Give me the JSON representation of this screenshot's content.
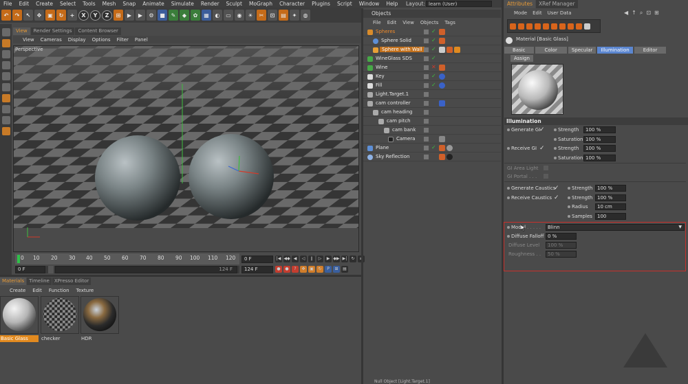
{
  "menubar": {
    "items": [
      "File",
      "Edit",
      "Create",
      "Select",
      "Tools",
      "Mesh",
      "Snap",
      "Animate",
      "Simulate",
      "Render",
      "Sculpt",
      "MoGraph",
      "Character",
      "Plugins",
      "Script",
      "Window",
      "Help"
    ],
    "layout_label": "Layout:",
    "layout_value": "learn (User)"
  },
  "toolbar": {
    "axis_x": "X",
    "axis_y": "Y",
    "axis_z": "Z"
  },
  "viewport": {
    "tabs": [
      "View",
      "Render Settings",
      "Content Browser"
    ],
    "menu": [
      "View",
      "Cameras",
      "Display",
      "Options",
      "Filter",
      "Panel"
    ],
    "label": "Perspective"
  },
  "timeline": {
    "ticks": [
      "0",
      "10",
      "20",
      "30",
      "40",
      "50",
      "60",
      "70",
      "80",
      "90",
      "100",
      "110",
      "120"
    ],
    "current": "0 F",
    "start": "0 F",
    "end_field": "124 F",
    "end": "124 F",
    "frame": "0 F"
  },
  "materials": {
    "tabs": [
      "Materials",
      "Timeline",
      "XPresso Editor"
    ],
    "menu": [
      "Create",
      "Edit",
      "Function",
      "Texture"
    ],
    "items": [
      {
        "name": "Basic Glass"
      },
      {
        "name": "checker"
      },
      {
        "name": "HDR"
      }
    ]
  },
  "objects": {
    "title": "Objects",
    "menu": [
      "File",
      "Edit",
      "View",
      "Objects",
      "Tags"
    ],
    "rows": [
      {
        "name": "Spheres"
      },
      {
        "name": "Sphere Solid"
      },
      {
        "name": "Sphere with Wall"
      },
      {
        "name": "WineGlass SDS"
      },
      {
        "name": "Wine"
      },
      {
        "name": "Key"
      },
      {
        "name": "Fill"
      },
      {
        "name": "Light.Target.1"
      },
      {
        "name": "cam controller"
      },
      {
        "name": "cam heading"
      },
      {
        "name": "cam pitch"
      },
      {
        "name": "cam bank"
      },
      {
        "name": "Camera"
      },
      {
        "name": "Plane"
      },
      {
        "name": "Sky Reflection"
      }
    ],
    "status": "Null Object [Light.Target.1]"
  },
  "attributes": {
    "tabs": [
      "Attributes",
      "XRef Manager"
    ],
    "menu": [
      "Mode",
      "Edit",
      "User Data"
    ],
    "title": "Material [Basic Glass]",
    "channel_tabs": [
      "Basic",
      "Color",
      "Specular",
      "Illumination",
      "Editor"
    ],
    "assign": "Assign",
    "section": "Illumination",
    "generate_gi": "Generate GI",
    "receive_gi": "Receive GI",
    "strength": "Strength",
    "saturation": "Saturation",
    "pct100": "100 %",
    "gi_area_light": "GI Area Light",
    "gi_portal": "GI Portal . . .",
    "generate_caustics": "Generate Caustics",
    "receive_caustics": "Receive Caustics",
    "radius": "Radius",
    "radius_val": "10 cm",
    "samples": "Samples",
    "samples_val": "100",
    "model": "Model",
    "model_dots": ". . . . .",
    "model_val": "Blinn",
    "diffuse_falloff": "Diffuse Falloff",
    "diffuse_falloff_val": "0 %",
    "diffuse_level": "Diffuse Level",
    "diffuse_level_val": "100 %",
    "roughness": "Roughness . .",
    "roughness_val": "50 %"
  },
  "colors": {
    "accent": "#e79a36",
    "selected": "#c2701c",
    "highlight_border": "#c9302b",
    "channel_active": "#5b86d0"
  }
}
